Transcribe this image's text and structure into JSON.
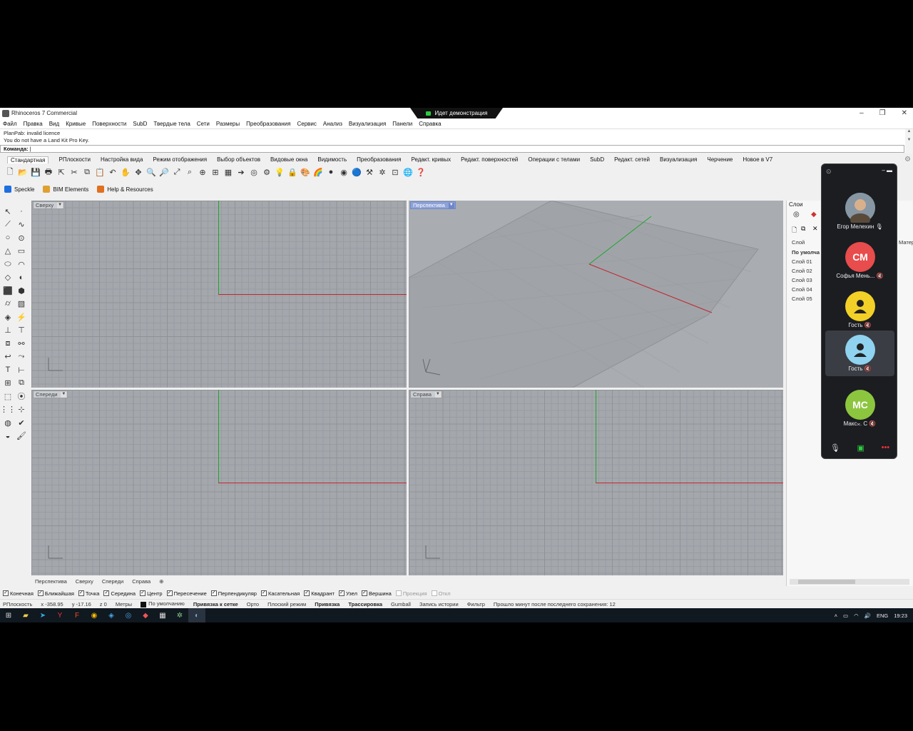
{
  "window": {
    "title": "Rhinoceros 7 Commercial",
    "share_banner": "Идет демонстрация"
  },
  "menu": [
    "Файл",
    "Правка",
    "Вид",
    "Кривые",
    "Поверхности",
    "SubD",
    "Твердые тела",
    "Сети",
    "Размеры",
    "Преобразования",
    "Сервис",
    "Анализ",
    "Визуализация",
    "Панели",
    "Справка"
  ],
  "command": {
    "history": [
      "PlanPab: invalid licence",
      "You do not have a Land Kit Pro Key."
    ],
    "prompt": "Команда:"
  },
  "toolbar_tabs": [
    "Стандартная",
    "РПлоскости",
    "Настройка вида",
    "Режим отображения",
    "Выбор объектов",
    "Видовые окна",
    "Видимость",
    "Преобразования",
    "Редакт. кривых",
    "Редакт. поверхностей",
    "Операции с телами",
    "SubD",
    "Редакт. сетей",
    "Визуализация",
    "Черчение",
    "Новое в V7"
  ],
  "plugins": [
    {
      "label": "Speckle",
      "color": "#1f6fe0"
    },
    {
      "label": "BIM Elements",
      "color": "#e0a030"
    },
    {
      "label": "Help & Resources",
      "color": "#e07020"
    }
  ],
  "viewports": {
    "top": "Сверху",
    "perspective": "Перспектива",
    "front": "Спереди",
    "right": "Справа"
  },
  "viewport_tabs": [
    "Перспектива",
    "Сверху",
    "Спереди",
    "Справа"
  ],
  "layers": {
    "title": "Слои",
    "column": "Слой",
    "column2": "Матер",
    "items": [
      "По умолча",
      "Слой 01",
      "Слой 02",
      "Слой 03",
      "Слой 04",
      "Слой 05"
    ]
  },
  "osnaps": [
    {
      "label": "Конечная",
      "on": true
    },
    {
      "label": "Ближайшая",
      "on": true
    },
    {
      "label": "Точка",
      "on": true
    },
    {
      "label": "Середина",
      "on": true
    },
    {
      "label": "Центр",
      "on": true
    },
    {
      "label": "Пересечение",
      "on": true
    },
    {
      "label": "Перпендикуляр",
      "on": true
    },
    {
      "label": "Касательная",
      "on": true
    },
    {
      "label": "Квадрант",
      "on": true
    },
    {
      "label": "Узел",
      "on": true
    },
    {
      "label": "Вершина",
      "on": true
    },
    {
      "label": "Проекция",
      "on": false
    },
    {
      "label": "Откл",
      "on": false
    }
  ],
  "status": {
    "cplane": "РПлоскость",
    "x": "x -358.95",
    "y": "y -17.16",
    "z": "z 0",
    "units": "Метры",
    "layer": "По умолчанию",
    "grid_snap": "Привязка к сетке",
    "ortho": "Орто",
    "planar": "Плоский режим",
    "osnap": "Привязка",
    "smarttrack": "Трассировка",
    "gumball": "Gumball",
    "history": "Запись истории",
    "filter": "Фильтр",
    "save_msg": "Прошло минут после последнего сохранения: 12"
  },
  "tray": {
    "lang": "ENG",
    "time": "19:23"
  },
  "call": {
    "participants": [
      {
        "initials": "",
        "name": "Егор Мелехин",
        "color": "#7a8a99"
      },
      {
        "initials": "СМ",
        "name": "Софья Мень...",
        "color": "#e84c4c"
      },
      {
        "initials": "",
        "name": "Гость",
        "color": "#f2d027"
      },
      {
        "initials": "",
        "name": "Гость",
        "color": "#8fd3f0"
      },
      {
        "initials": "МС",
        "name": "Макс... С",
        "color": "#8cc63f"
      }
    ]
  }
}
